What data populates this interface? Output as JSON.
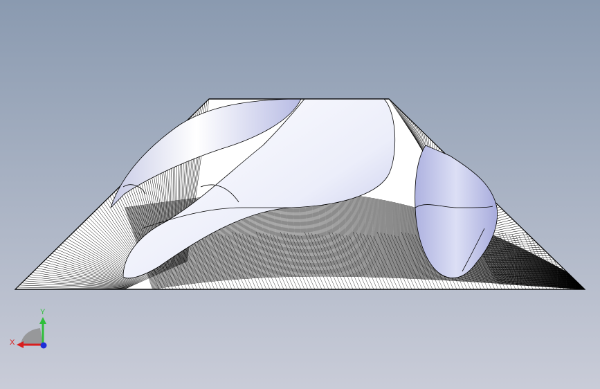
{
  "viewport": {
    "background_top": "#8a9ab0",
    "background_bottom": "#c9ccd8",
    "model_fill": "#ffffff",
    "model_shade": "#b9bde6",
    "wire_color": "#000000"
  },
  "triad": {
    "x_label": "X",
    "y_label": "Y",
    "x_color": "#d81e1e",
    "y_color": "#2fbf3a",
    "z_color": "#1e2fd8"
  }
}
